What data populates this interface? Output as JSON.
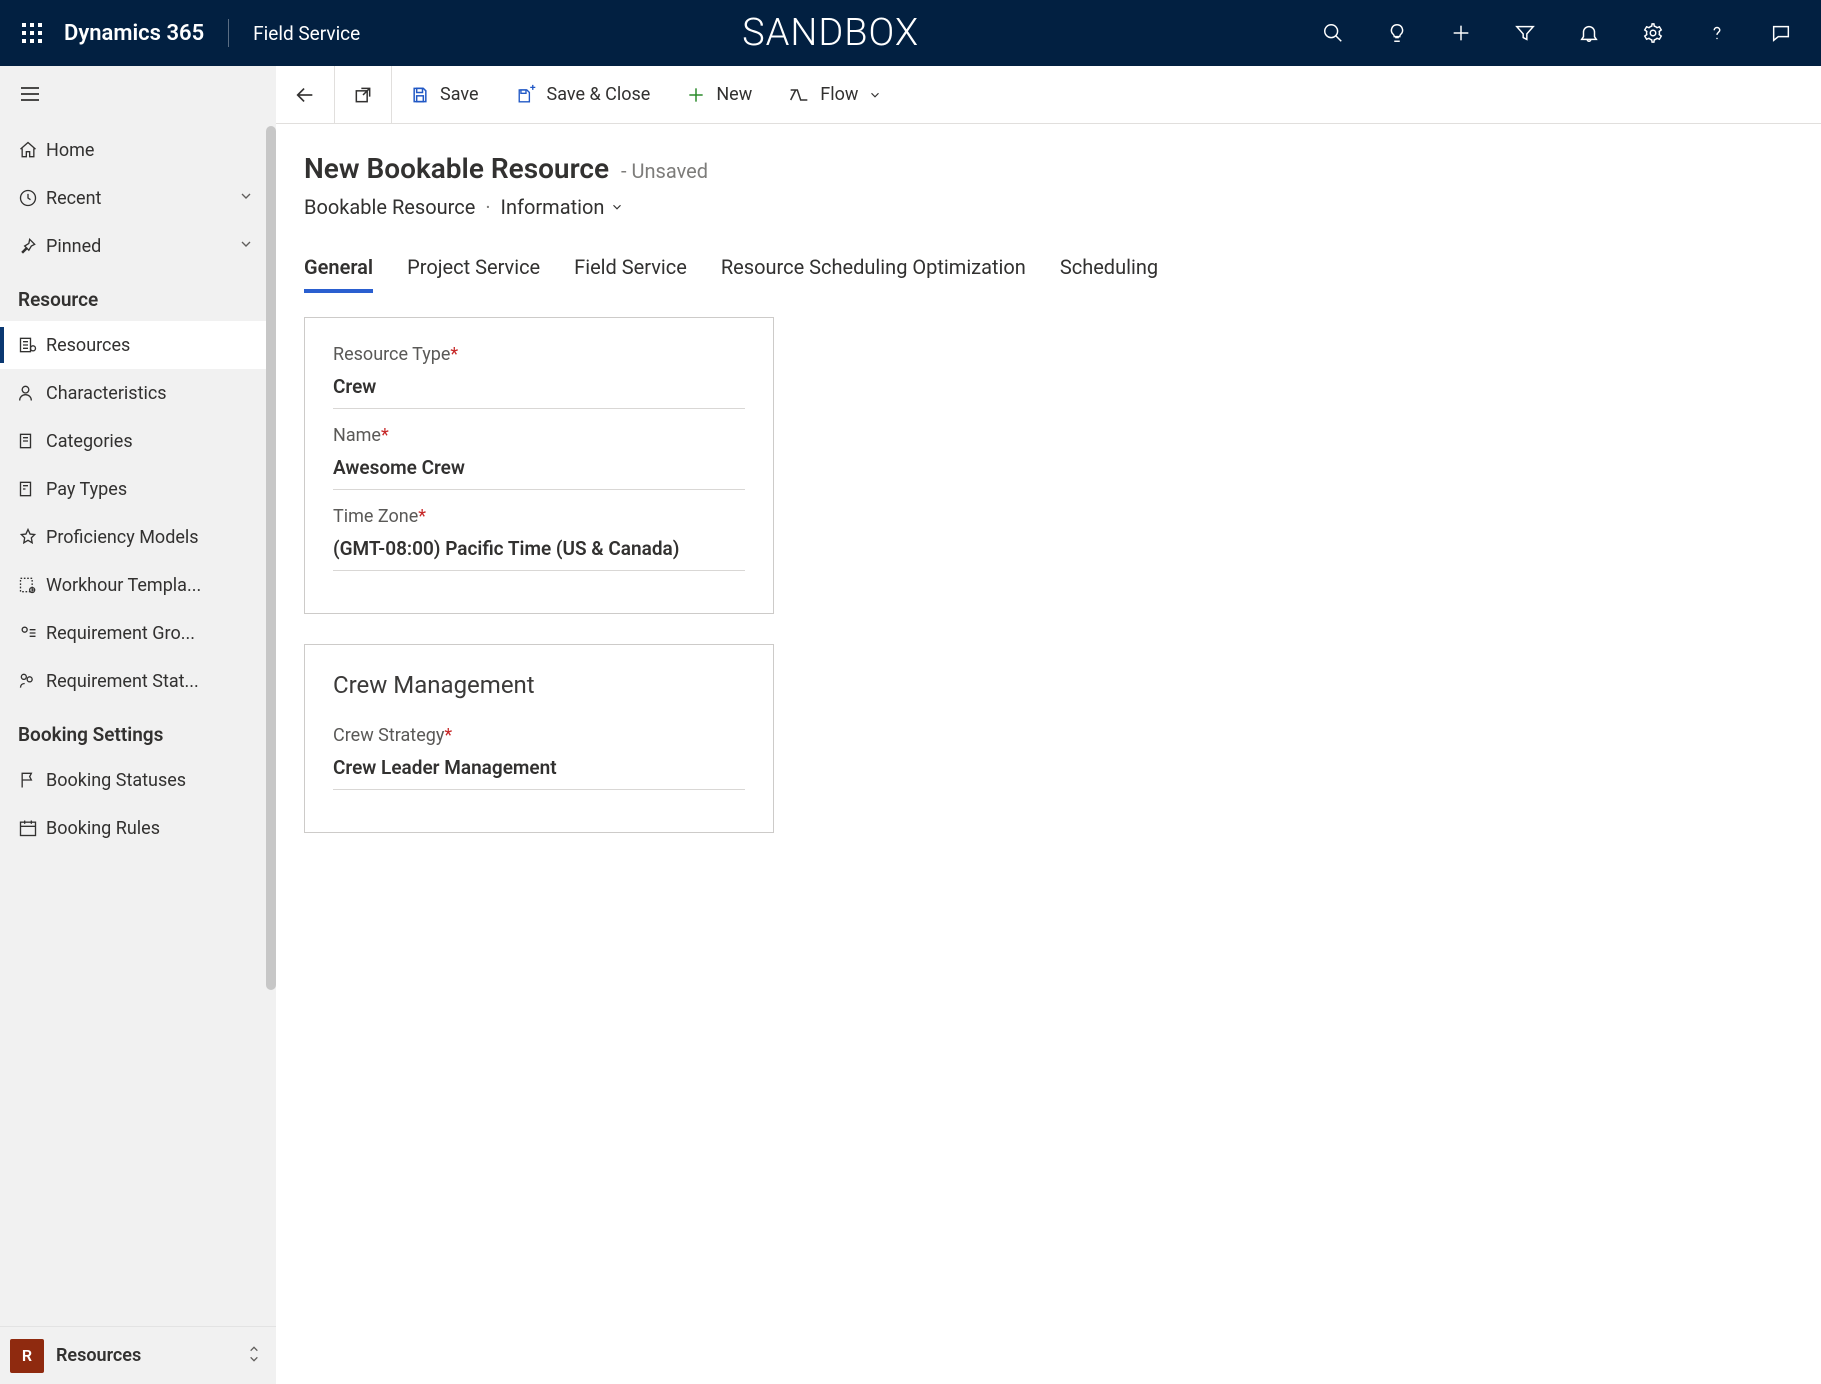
{
  "topbar": {
    "brand": "Dynamics 365",
    "app": "Field Service",
    "center": "SANDBOX"
  },
  "sidebar": {
    "home": "Home",
    "recent": "Recent",
    "pinned": "Pinned",
    "section_resource": "Resource",
    "items_resource": [
      "Resources",
      "Characteristics",
      "Categories",
      "Pay Types",
      "Proficiency Models",
      "Workhour Templa...",
      "Requirement Gro...",
      "Requirement Stat..."
    ],
    "section_booking": "Booking Settings",
    "items_booking": [
      "Booking Statuses",
      "Booking Rules"
    ],
    "area_badge": "R",
    "area_label": "Resources"
  },
  "commandbar": {
    "save": "Save",
    "save_close": "Save & Close",
    "new": "New",
    "flow": "Flow"
  },
  "header": {
    "title": "New Bookable Resource",
    "status": "- Unsaved",
    "entity": "Bookable Resource",
    "form": "Information"
  },
  "tabs": [
    "General",
    "Project Service",
    "Field Service",
    "Resource Scheduling Optimization",
    "Scheduling"
  ],
  "form": {
    "resource_type_label": "Resource Type",
    "resource_type_value": "Crew",
    "name_label": "Name",
    "name_value": "Awesome Crew",
    "timezone_label": "Time Zone",
    "timezone_value": "(GMT-08:00) Pacific Time (US & Canada)",
    "crew_section": "Crew Management",
    "crew_strategy_label": "Crew Strategy",
    "crew_strategy_value": "Crew Leader Management"
  }
}
